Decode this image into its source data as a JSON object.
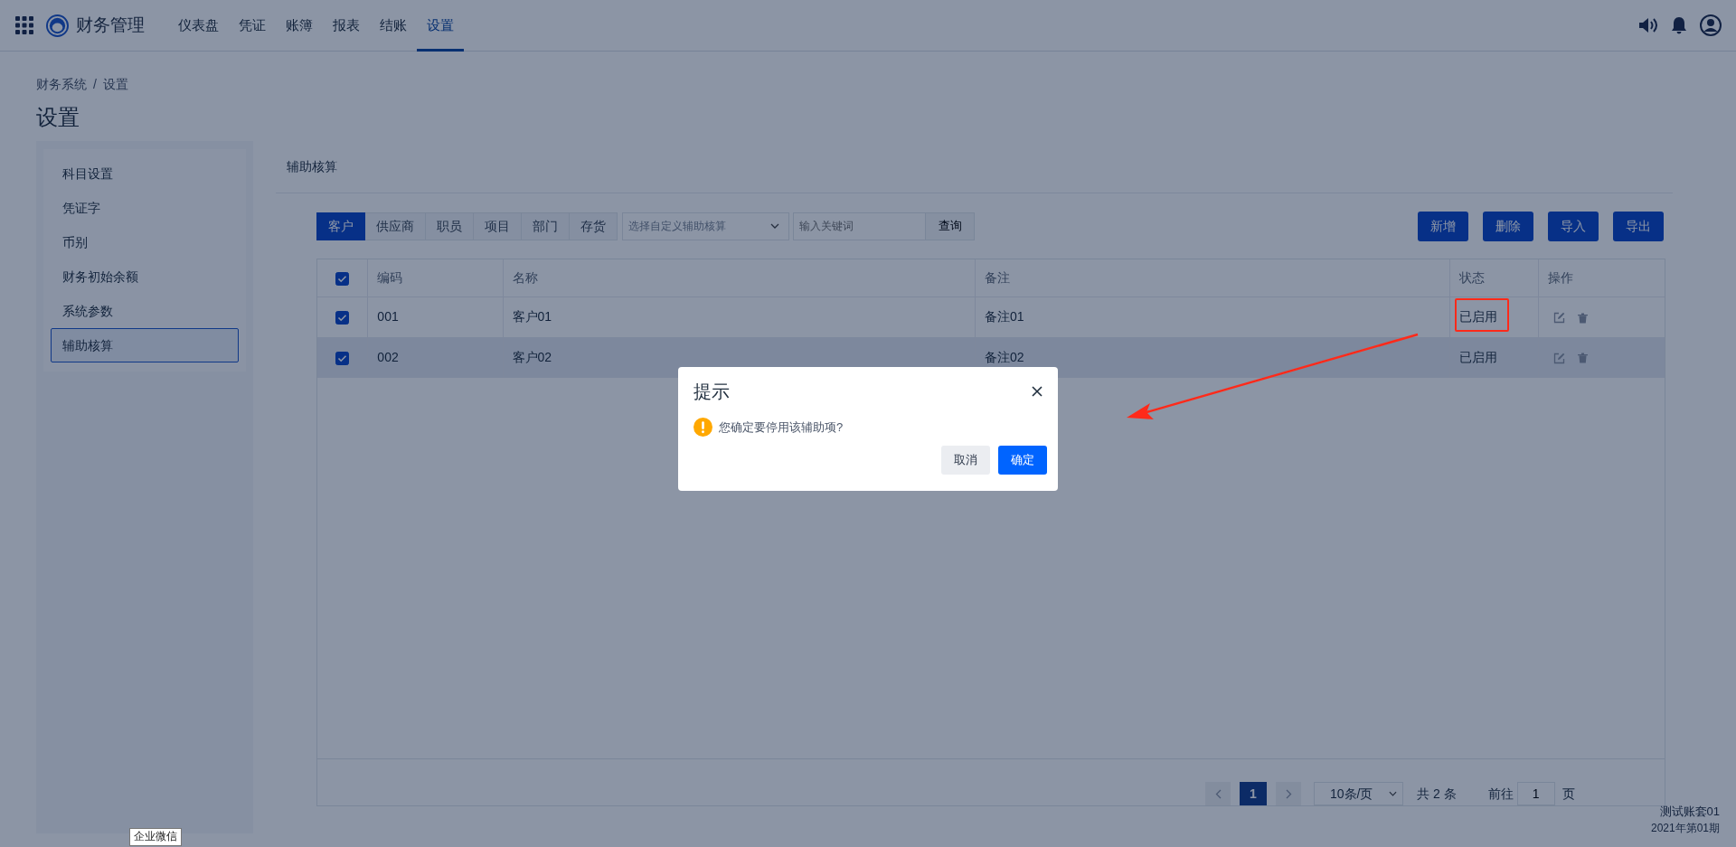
{
  "navbar": {
    "brand": "财务管理",
    "items": [
      {
        "label": "仪表盘",
        "selected": false
      },
      {
        "label": "凭证",
        "selected": false
      },
      {
        "label": "账簿",
        "selected": false
      },
      {
        "label": "报表",
        "selected": false
      },
      {
        "label": "结账",
        "selected": false
      },
      {
        "label": "设置",
        "selected": true
      }
    ]
  },
  "breadcrumb": {
    "items": [
      "财务系统",
      "设置"
    ],
    "separator": "/"
  },
  "page_title": "设置",
  "sidebar": {
    "items": [
      {
        "label": "科目设置",
        "selected": false
      },
      {
        "label": "凭证字",
        "selected": false
      },
      {
        "label": "币别",
        "selected": false
      },
      {
        "label": "财务初始余额",
        "selected": false
      },
      {
        "label": "系统参数",
        "selected": false
      },
      {
        "label": "辅助核算",
        "selected": true
      }
    ]
  },
  "section_title": "辅助核算",
  "tabs": [
    {
      "label": "客户",
      "selected": true
    },
    {
      "label": "供应商",
      "selected": false
    },
    {
      "label": "职员",
      "selected": false
    },
    {
      "label": "项目",
      "selected": false
    },
    {
      "label": "部门",
      "selected": false
    },
    {
      "label": "存货",
      "selected": false
    }
  ],
  "custom_select": {
    "placeholder": "选择自定义辅助核算"
  },
  "search": {
    "placeholder": "输入关键词",
    "button": "查询"
  },
  "actions": [
    "新增",
    "删除",
    "导入",
    "导出"
  ],
  "table": {
    "all_checked": true,
    "columns": [
      "编码",
      "名称",
      "备注",
      "状态",
      "操作"
    ],
    "rows": [
      {
        "checked": true,
        "highlighted": false,
        "code": "001",
        "name": "客户01",
        "note": "备注01",
        "status": "已启用"
      },
      {
        "checked": true,
        "highlighted": true,
        "code": "002",
        "name": "客户02",
        "note": "备注02",
        "status": "已启用"
      }
    ]
  },
  "pagination": {
    "current": "1",
    "page_size": "10条/页",
    "total": "共 2 条",
    "goto_label": "前往",
    "goto_value": "1",
    "goto_suffix": "页"
  },
  "account": {
    "name": "测试账套01",
    "period": "2021年第01期"
  },
  "dialog": {
    "title": "提示",
    "message": "您确定要停用该辅助项?",
    "cancel": "取消",
    "confirm": "确定"
  },
  "tooltip": "企业微信"
}
